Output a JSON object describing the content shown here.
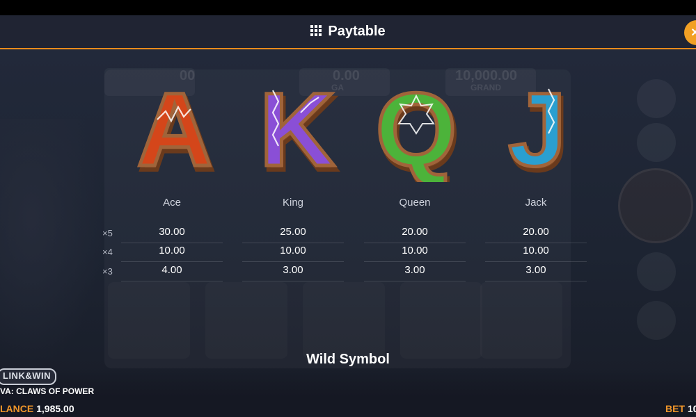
{
  "header": {
    "title": "Paytable",
    "menu_icon": "grid-icon",
    "close_icon": "close-icon",
    "close_label": "×"
  },
  "background": {
    "jackpots": [
      {
        "amount": "00",
        "label": ""
      },
      {
        "amount": "0.00",
        "label": "GA"
      },
      {
        "amount": "10,000.00",
        "label": "GRAND"
      }
    ]
  },
  "symbols": [
    {
      "glyph": "A",
      "name": "Ace",
      "color": "#d4461a",
      "payouts": [
        "30.00",
        "10.00",
        "4.00"
      ]
    },
    {
      "glyph": "K",
      "name": "King",
      "color": "#8a4fd6",
      "payouts": [
        "25.00",
        "10.00",
        "3.00"
      ]
    },
    {
      "glyph": "Q",
      "name": "Queen",
      "color": "#4cb33a",
      "payouts": [
        "20.00",
        "10.00",
        "3.00"
      ]
    },
    {
      "glyph": "J",
      "name": "Jack",
      "color": "#2a9fd0",
      "payouts": [
        "20.00",
        "10.00",
        "3.00"
      ]
    }
  ],
  "multipliers": [
    "×5",
    "×4",
    "×3"
  ],
  "wild_title": "Wild Symbol",
  "footer": {
    "logo": "LINK&WIN",
    "game_name": "VA: CLAWS OF POWER",
    "balance_label": "LANCE",
    "balance_value": "1,985.00",
    "bet_label": "BET",
    "bet_value": "10"
  }
}
